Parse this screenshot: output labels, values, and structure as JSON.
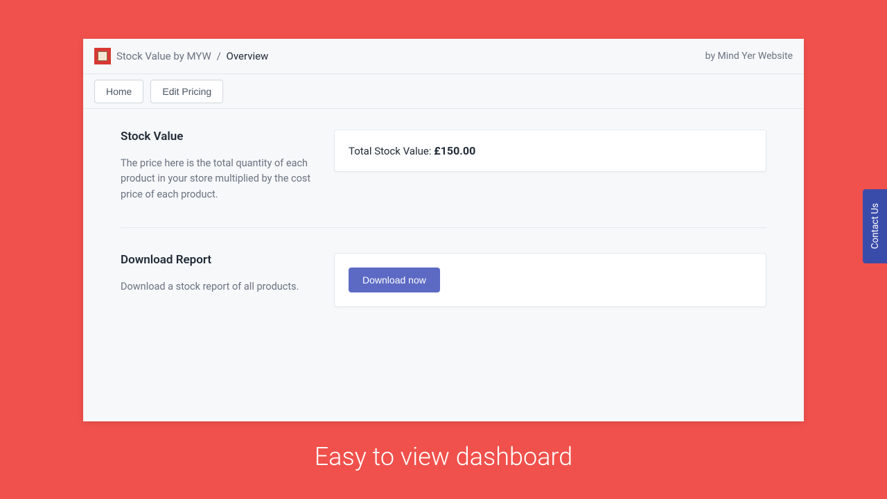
{
  "header": {
    "app_name": "Stock Value by MYW",
    "current_page": "Overview",
    "separator": "/",
    "attribution": "by Mind Yer Website"
  },
  "toolbar": {
    "home_label": "Home",
    "edit_pricing_label": "Edit Pricing"
  },
  "sections": {
    "stock_value": {
      "title": "Stock Value",
      "description": "The price here is the total quantity of each product in your store multiplied by the cost price of each product.",
      "card_label": "Total Stock Value: ",
      "card_value": "£150.00"
    },
    "download_report": {
      "title": "Download Report",
      "description": "Download a stock report of all products.",
      "button_label": "Download now"
    }
  },
  "contact_tab": {
    "label": "Contact Us"
  },
  "caption": "Easy to view dashboard"
}
